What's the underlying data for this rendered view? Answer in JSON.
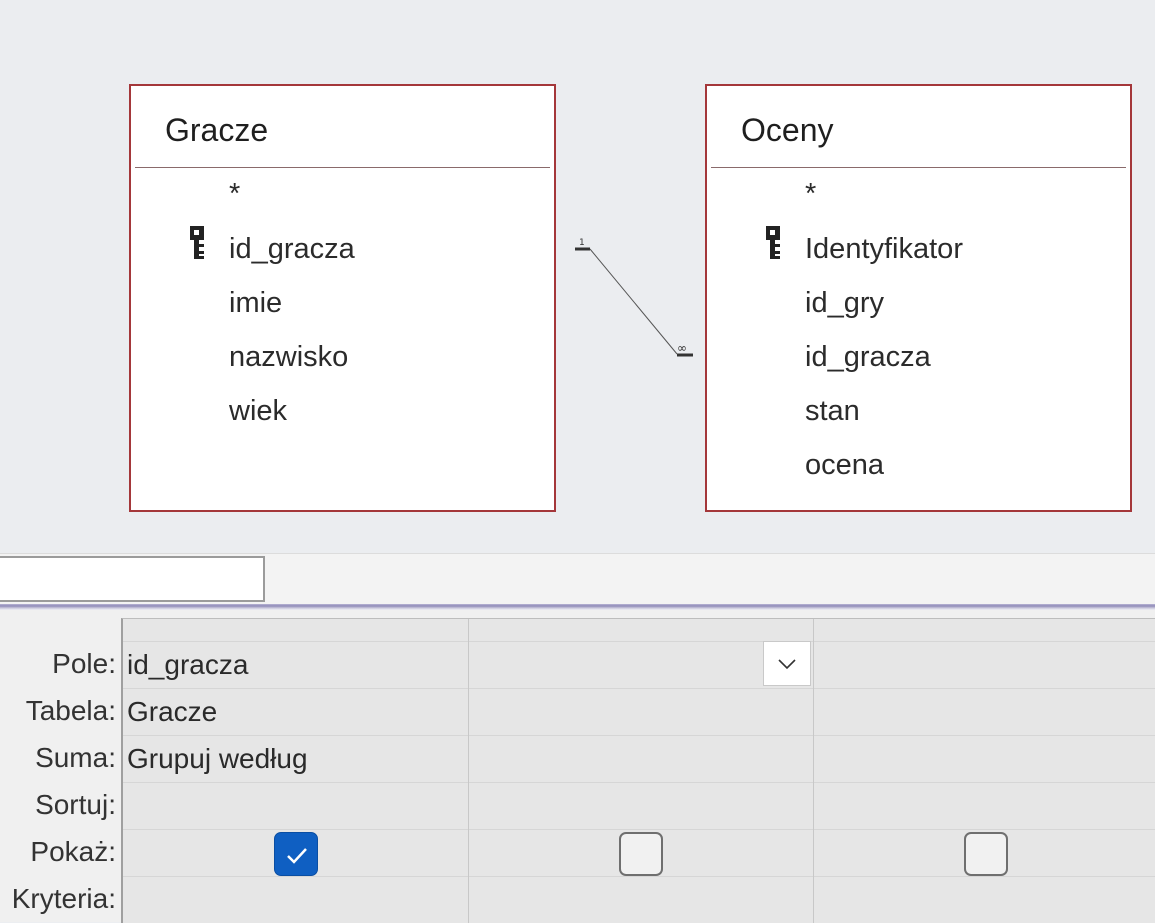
{
  "tables": [
    {
      "title": "Gracze",
      "fields": [
        "*",
        "id_gracza",
        "imie",
        "nazwisko",
        "wiek"
      ],
      "key_field": "id_gracza"
    },
    {
      "title": "Oceny",
      "fields": [
        "*",
        "Identyfikator",
        "id_gry",
        "id_gracza",
        "stan",
        "ocena"
      ],
      "key_field": "Identyfikator"
    }
  ],
  "relationship": {
    "one_label": "1",
    "many_label": "∞"
  },
  "grid": {
    "row_labels": {
      "pole": "Pole:",
      "tabela": "Tabela:",
      "suma": "Suma:",
      "sortuj": "Sortuj:",
      "pokaz": "Pokaż:",
      "kryteria": "Kryteria:"
    },
    "columns": [
      {
        "pole": "id_gracza",
        "tabela": "Gracze",
        "suma": "Grupuj według",
        "sortuj": "",
        "pokaz": true,
        "kryteria": ""
      },
      {
        "pole": "",
        "tabela": "",
        "suma": "",
        "sortuj": "",
        "pokaz": false,
        "kryteria": ""
      },
      {
        "pole": "",
        "tabela": "",
        "suma": "",
        "sortuj": "",
        "pokaz": false,
        "kryteria": ""
      }
    ]
  },
  "colors": {
    "table_border": "#a4373a",
    "checkbox_on": "#0f5fc2"
  },
  "icons": {
    "key": "primary-key-icon",
    "dropdown": "chevron-down-icon",
    "check": "checkmark-icon"
  }
}
